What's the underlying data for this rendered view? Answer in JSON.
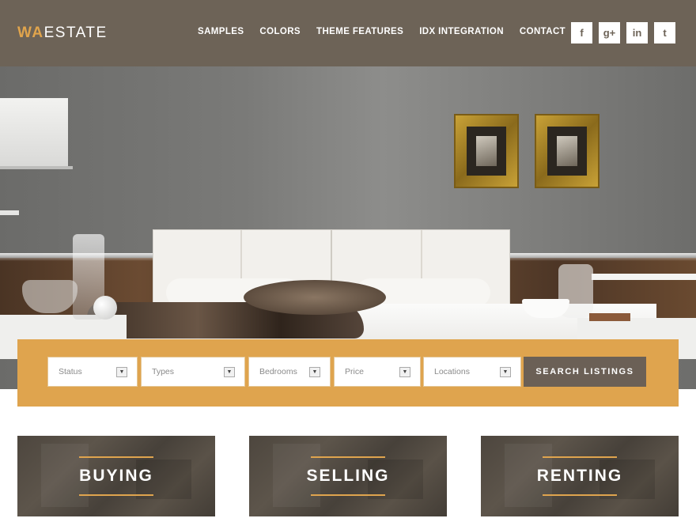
{
  "brand": {
    "logo_accent": "WA",
    "logo_rest": "ESTATE",
    "accent_color": "#e0a44c",
    "header_color": "#6d6357"
  },
  "nav": {
    "items": [
      "SAMPLES",
      "COLORS",
      "THEME FEATURES",
      "IDX INTEGRATION",
      "CONTACT"
    ]
  },
  "social": [
    {
      "icon": "facebook-icon",
      "glyph": "f"
    },
    {
      "icon": "google-plus-icon",
      "glyph": "g+"
    },
    {
      "icon": "linkedin-icon",
      "glyph": "in"
    },
    {
      "icon": "twitter-icon",
      "glyph": "t"
    }
  ],
  "search": {
    "fields": [
      "Status",
      "Types",
      "Bedrooms",
      "Price",
      "Locations"
    ],
    "button_label": "SEARCH LISTINGS",
    "bar_color": "#dfa44e"
  },
  "cards": [
    "BUYING",
    "SELLING",
    "RENTING"
  ]
}
